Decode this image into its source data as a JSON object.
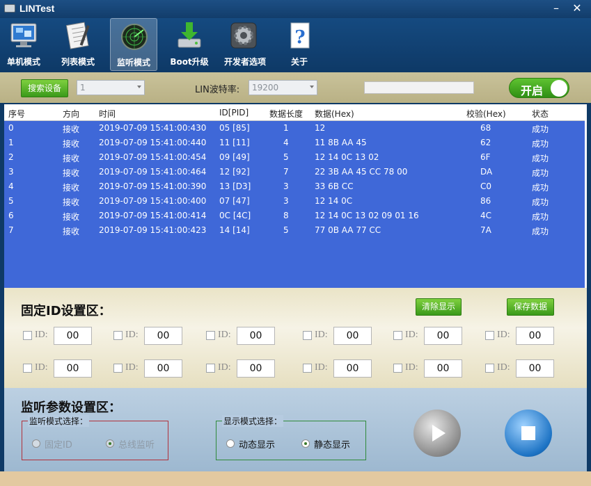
{
  "window": {
    "title": "LINTest",
    "minimize": "–",
    "close": "✕"
  },
  "toolbar": [
    {
      "label": "单机模式",
      "icon": "monitor-icon"
    },
    {
      "label": "列表模式",
      "icon": "notepad-icon"
    },
    {
      "label": "监听模式",
      "icon": "radar-icon",
      "active": true
    },
    {
      "label": "Boot升级",
      "icon": "download-drive-icon"
    },
    {
      "label": "开发者选项",
      "icon": "gear-icon"
    },
    {
      "label": "关于",
      "icon": "help-icon"
    }
  ],
  "controls": {
    "search_button": "搜索设备",
    "device_value": "1",
    "baud_label": "LIN波特率:",
    "baud_value": "19200",
    "toggle_label": "开启",
    "toggle_color": "#3fa81f"
  },
  "table": {
    "headers": [
      "序号",
      "方向",
      "时间",
      "ID[PID]",
      "数据长度",
      "数据(Hex)",
      "校验(Hex)",
      "状态"
    ],
    "rows": [
      [
        "0",
        "接收",
        "2019-07-09 15:41:00:430",
        "05 [85]",
        "1",
        "12",
        "68",
        "成功"
      ],
      [
        "1",
        "接收",
        "2019-07-09 15:41:00:440",
        "11 [11]",
        "4",
        "11 8B AA 45",
        "62",
        "成功"
      ],
      [
        "2",
        "接收",
        "2019-07-09 15:41:00:454",
        "09 [49]",
        "5",
        "12 14 0C 13 02",
        "6F",
        "成功"
      ],
      [
        "3",
        "接收",
        "2019-07-09 15:41:00:464",
        "12 [92]",
        "7",
        "22 3B AA 45 CC 78 00",
        "DA",
        "成功"
      ],
      [
        "4",
        "接收",
        "2019-07-09 15:41:00:390",
        "13 [D3]",
        "3",
        "33 6B CC",
        "C0",
        "成功"
      ],
      [
        "5",
        "接收",
        "2019-07-09 15:41:00:400",
        "07 [47]",
        "3",
        "12 14 0C",
        "86",
        "成功"
      ],
      [
        "6",
        "接收",
        "2019-07-09 15:41:00:414",
        "0C [4C]",
        "8",
        "12 14 0C 13 02 09 01 16",
        "4C",
        "成功"
      ],
      [
        "7",
        "接收",
        "2019-07-09 15:41:00:423",
        "14 [14]",
        "5",
        "77 0B AA 77 CC",
        "7A",
        "成功"
      ]
    ],
    "row_color": "#3f68d8"
  },
  "fixed": {
    "title": "固定ID设置区：",
    "clear_button": "清除显示",
    "save_button": "保存数据",
    "id_label": "ID:",
    "row1": [
      "00",
      "00",
      "00",
      "00",
      "00",
      "00"
    ],
    "row2": [
      "00",
      "00",
      "00",
      "00",
      "00",
      "00"
    ]
  },
  "monitor": {
    "title": "监听参数设置区：",
    "mode_group": "监听模式选择：",
    "mode_fixed": "固定ID",
    "mode_bus": "总线监听",
    "display_group": "显示模式选择：",
    "display_dynamic": "动态显示",
    "display_static": "静态显示",
    "play_icon": "play-icon",
    "stop_icon": "stop-icon"
  }
}
